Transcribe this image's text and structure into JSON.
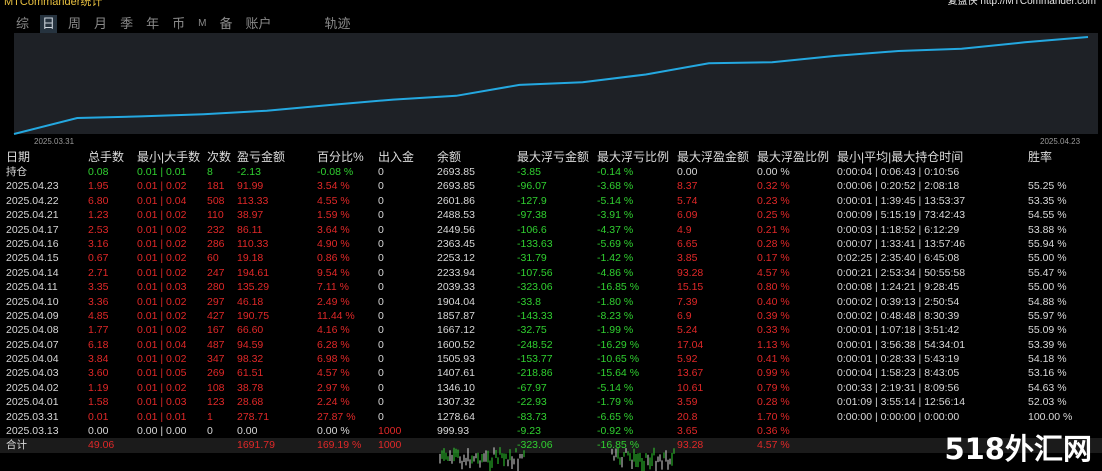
{
  "app": {
    "title": "MTCommander统计",
    "right_title": "复盘侠 http://MTCommander.com"
  },
  "tabs": [
    "综",
    "日",
    "周",
    "月",
    "季",
    "年",
    "币",
    "M",
    "备",
    "账户",
    "轨迹"
  ],
  "active_tab": "日",
  "chart": {
    "x_start_label": "2025.03.31",
    "x_end_label": "2025.04.23",
    "line_color": "#24a8e0",
    "values": [
      999.93,
      1278.64,
      1307.32,
      1346.1,
      1407.61,
      1505.93,
      1600.52,
      1667.12,
      1857.87,
      1904.04,
      2039.33,
      2233.94,
      2253.12,
      2363.45,
      2449.56,
      2488.53,
      2601.86,
      2693.85
    ]
  },
  "table": {
    "headers": [
      "日期",
      "总手数",
      "最小|大手数",
      "次数",
      "盈亏金额",
      "百分比%",
      "出入金",
      "余额",
      "最大浮亏金额",
      "最大浮亏比例",
      "最大浮盈金额",
      "最大浮盈比例",
      "最小|平均|最大持仓时间",
      "胜率"
    ],
    "rows": [
      {
        "cells": [
          "持仓",
          "0.08",
          "0.01 | 0.01",
          "8",
          "-2.13",
          "-0.08 %",
          "0",
          "2693.85",
          "-3.85",
          "-0.14 %",
          "0.00",
          "0.00 %",
          "0:00:04 | 0:06:43 | 0:10:56",
          ""
        ],
        "colors": [
          "w",
          "g",
          "g",
          "g",
          "g",
          "g",
          "w",
          "w",
          "g",
          "g",
          "w",
          "w",
          "w",
          "w"
        ]
      },
      {
        "cells": [
          "2025.04.23",
          "1.95",
          "0.01 | 0.02",
          "181",
          "91.99",
          "3.54 %",
          "0",
          "2693.85",
          "-96.07",
          "-3.68 %",
          "8.37",
          "0.32 %",
          "0:00:06 | 0:20:52 | 2:08:18",
          "55.25 %"
        ],
        "colors": [
          "w",
          "r",
          "r",
          "r",
          "r",
          "r",
          "w",
          "w",
          "g",
          "g",
          "r",
          "r",
          "w",
          "w"
        ]
      },
      {
        "cells": [
          "2025.04.22",
          "6.80",
          "0.01 | 0.04",
          "508",
          "113.33",
          "4.55 %",
          "0",
          "2601.86",
          "-127.9",
          "-5.14 %",
          "5.74",
          "0.23 %",
          "0:00:01 | 1:39:45 | 13:53:37",
          "53.35 %"
        ],
        "colors": [
          "w",
          "r",
          "r",
          "r",
          "r",
          "r",
          "w",
          "w",
          "g",
          "g",
          "r",
          "r",
          "w",
          "w"
        ]
      },
      {
        "cells": [
          "2025.04.21",
          "1.23",
          "0.01 | 0.02",
          "110",
          "38.97",
          "1.59 %",
          "0",
          "2488.53",
          "-97.38",
          "-3.91 %",
          "6.09",
          "0.25 %",
          "0:00:09 | 5:15:19 | 73:42:43",
          "54.55 %"
        ],
        "colors": [
          "w",
          "r",
          "r",
          "r",
          "r",
          "r",
          "w",
          "w",
          "g",
          "g",
          "r",
          "r",
          "w",
          "w"
        ]
      },
      {
        "cells": [
          "2025.04.17",
          "2.53",
          "0.01 | 0.02",
          "232",
          "86.11",
          "3.64 %",
          "0",
          "2449.56",
          "-106.6",
          "-4.37 %",
          "4.9",
          "0.21 %",
          "0:00:03 | 1:18:52 | 6:12:29",
          "53.88 %"
        ],
        "colors": [
          "w",
          "r",
          "r",
          "r",
          "r",
          "r",
          "w",
          "w",
          "g",
          "g",
          "r",
          "r",
          "w",
          "w"
        ]
      },
      {
        "cells": [
          "2025.04.16",
          "3.16",
          "0.01 | 0.02",
          "286",
          "110.33",
          "4.90 %",
          "0",
          "2363.45",
          "-133.63",
          "-5.69 %",
          "6.65",
          "0.28 %",
          "0:00:07 | 1:33:41 | 13:57:46",
          "55.94 %"
        ],
        "colors": [
          "w",
          "r",
          "r",
          "r",
          "r",
          "r",
          "w",
          "w",
          "g",
          "g",
          "r",
          "r",
          "w",
          "w"
        ]
      },
      {
        "cells": [
          "2025.04.15",
          "0.67",
          "0.01 | 0.02",
          "60",
          "19.18",
          "0.86 %",
          "0",
          "2253.12",
          "-31.79",
          "-1.42 %",
          "3.85",
          "0.17 %",
          "0:02:25 | 2:35:40 | 6:45:08",
          "55.00 %"
        ],
        "colors": [
          "w",
          "r",
          "r",
          "r",
          "r",
          "r",
          "w",
          "w",
          "g",
          "g",
          "r",
          "r",
          "w",
          "w"
        ]
      },
      {
        "cells": [
          "2025.04.14",
          "2.71",
          "0.01 | 0.02",
          "247",
          "194.61",
          "9.54 %",
          "0",
          "2233.94",
          "-107.56",
          "-4.86 %",
          "93.28",
          "4.57 %",
          "0:00:21 | 2:53:34 | 50:55:58",
          "55.47 %"
        ],
        "colors": [
          "w",
          "r",
          "r",
          "r",
          "r",
          "r",
          "w",
          "w",
          "g",
          "g",
          "r",
          "r",
          "w",
          "w"
        ]
      },
      {
        "cells": [
          "2025.04.11",
          "3.35",
          "0.01 | 0.03",
          "280",
          "135.29",
          "7.11 %",
          "0",
          "2039.33",
          "-323.06",
          "-16.85 %",
          "15.15",
          "0.80 %",
          "0:00:08 | 1:24:21 | 9:28:45",
          "55.00 %"
        ],
        "colors": [
          "w",
          "r",
          "r",
          "r",
          "r",
          "r",
          "w",
          "w",
          "g",
          "g",
          "r",
          "r",
          "w",
          "w"
        ]
      },
      {
        "cells": [
          "2025.04.10",
          "3.36",
          "0.01 | 0.02",
          "297",
          "46.18",
          "2.49 %",
          "0",
          "1904.04",
          "-33.8",
          "-1.80 %",
          "7.39",
          "0.40 %",
          "0:00:02 | 0:39:13 | 2:50:54",
          "54.88 %"
        ],
        "colors": [
          "w",
          "r",
          "r",
          "r",
          "r",
          "r",
          "w",
          "w",
          "g",
          "g",
          "r",
          "r",
          "w",
          "w"
        ]
      },
      {
        "cells": [
          "2025.04.09",
          "4.85",
          "0.01 | 0.02",
          "427",
          "190.75",
          "11.44 %",
          "0",
          "1857.87",
          "-143.33",
          "-8.23 %",
          "6.9",
          "0.39 %",
          "0:00:02 | 0:48:48 | 8:30:39",
          "55.97 %"
        ],
        "colors": [
          "w",
          "r",
          "r",
          "r",
          "r",
          "r",
          "w",
          "w",
          "g",
          "g",
          "r",
          "r",
          "w",
          "w"
        ]
      },
      {
        "cells": [
          "2025.04.08",
          "1.77",
          "0.01 | 0.02",
          "167",
          "66.60",
          "4.16 %",
          "0",
          "1667.12",
          "-32.75",
          "-1.99 %",
          "5.24",
          "0.33 %",
          "0:00:01 | 1:07:18 | 3:51:42",
          "55.09 %"
        ],
        "colors": [
          "w",
          "r",
          "r",
          "r",
          "r",
          "r",
          "w",
          "w",
          "g",
          "g",
          "r",
          "r",
          "w",
          "w"
        ]
      },
      {
        "cells": [
          "2025.04.07",
          "6.18",
          "0.01 | 0.04",
          "487",
          "94.59",
          "6.28 %",
          "0",
          "1600.52",
          "-248.52",
          "-16.29 %",
          "17.04",
          "1.13 %",
          "0:00:01 | 3:56:38 | 54:34:01",
          "53.39 %"
        ],
        "colors": [
          "w",
          "r",
          "r",
          "r",
          "r",
          "r",
          "w",
          "w",
          "g",
          "g",
          "r",
          "r",
          "w",
          "w"
        ]
      },
      {
        "cells": [
          "2025.04.04",
          "3.84",
          "0.01 | 0.02",
          "347",
          "98.32",
          "6.98 %",
          "0",
          "1505.93",
          "-153.77",
          "-10.65 %",
          "5.92",
          "0.41 %",
          "0:00:01 | 0:28:33 | 5:43:19",
          "54.18 %"
        ],
        "colors": [
          "w",
          "r",
          "r",
          "r",
          "r",
          "r",
          "w",
          "w",
          "g",
          "g",
          "r",
          "r",
          "w",
          "w"
        ]
      },
      {
        "cells": [
          "2025.04.03",
          "3.60",
          "0.01 | 0.05",
          "269",
          "61.51",
          "4.57 %",
          "0",
          "1407.61",
          "-218.86",
          "-15.64 %",
          "13.67",
          "0.99 %",
          "0:00:04 | 1:58:23 | 8:43:05",
          "53.16 %"
        ],
        "colors": [
          "w",
          "r",
          "r",
          "r",
          "r",
          "r",
          "w",
          "w",
          "g",
          "g",
          "r",
          "r",
          "w",
          "w"
        ]
      },
      {
        "cells": [
          "2025.04.02",
          "1.19",
          "0.01 | 0.02",
          "108",
          "38.78",
          "2.97 %",
          "0",
          "1346.10",
          "-67.97",
          "-5.14 %",
          "10.61",
          "0.79 %",
          "0:00:33 | 2:19:31 | 8:09:56",
          "54.63 %"
        ],
        "colors": [
          "w",
          "r",
          "r",
          "r",
          "r",
          "r",
          "w",
          "w",
          "g",
          "g",
          "r",
          "r",
          "w",
          "w"
        ]
      },
      {
        "cells": [
          "2025.04.01",
          "1.58",
          "0.01 | 0.03",
          "123",
          "28.68",
          "2.24 %",
          "0",
          "1307.32",
          "-22.93",
          "-1.79 %",
          "3.59",
          "0.28 %",
          "0:01:09 | 3:55:14 | 12:56:14",
          "52.03 %"
        ],
        "colors": [
          "w",
          "r",
          "r",
          "r",
          "r",
          "r",
          "w",
          "w",
          "g",
          "g",
          "r",
          "r",
          "w",
          "w"
        ]
      },
      {
        "cells": [
          "2025.03.31",
          "0.01",
          "0.01 | 0.01",
          "1",
          "278.71",
          "27.87 %",
          "0",
          "1278.64",
          "-83.73",
          "-6.65 %",
          "20.8",
          "1.70 %",
          "0:00:00 | 0:00:00 | 0:00:00",
          "100.00 %"
        ],
        "colors": [
          "w",
          "r",
          "r",
          "r",
          "r",
          "r",
          "w",
          "w",
          "g",
          "g",
          "r",
          "r",
          "w",
          "w"
        ]
      },
      {
        "cells": [
          "2025.03.13",
          "0.00",
          "0.00 | 0.00",
          "0",
          "0.00",
          "0.00 %",
          "1000",
          "999.93",
          "-9.23",
          "-0.92 %",
          "3.65",
          "0.36 %",
          "",
          ""
        ],
        "colors": [
          "w",
          "w",
          "w",
          "w",
          "w",
          "w",
          "r",
          "w",
          "g",
          "g",
          "r",
          "r",
          "w",
          "w"
        ]
      }
    ],
    "total": {
      "cells": [
        "合计",
        "49.06",
        "",
        "",
        "1691.79",
        "169.19 %",
        "1000",
        "",
        "-323.06",
        "-16.85 %",
        "93.28",
        "4.57 %",
        "",
        ""
      ],
      "colors": [
        "w",
        "r",
        "w",
        "w",
        "r",
        "r",
        "r",
        "w",
        "g",
        "g",
        "r",
        "r",
        "w",
        "w"
      ]
    }
  },
  "watermark": "518外汇网"
}
